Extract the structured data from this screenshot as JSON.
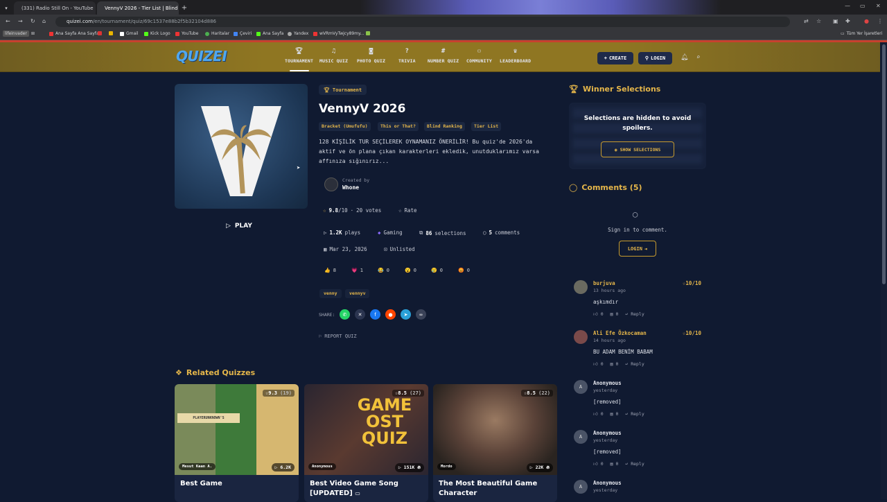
{
  "browser": {
    "tabs": [
      {
        "title": "(331) Radio Still On - YouTube"
      },
      {
        "title": "VennyV 2026 - Tier List | Blind R"
      }
    ],
    "url_domain": "quizei.com",
    "url_path": "/en/tournament/quiz/69c1537e88b2f5b32104d886",
    "bookmarks": [
      "lifeinvader",
      "Ana Sayfa Ana Sayfa",
      "Gmail",
      "Kick Logo",
      "YouTube",
      "Haritalar",
      "Çeviri",
      "Ana Sayfa",
      "Yandex",
      "wVRmVyTwjcy89my...",
      "Tüm Yer İşaretleri"
    ]
  },
  "site": {
    "logo": "QUIZEI",
    "nav": [
      {
        "label": "TOURNAMENT",
        "icon": "trophy-icon"
      },
      {
        "label": "MUSIC QUIZ",
        "icon": "music-icon"
      },
      {
        "label": "PHOTO QUIZ",
        "icon": "camera-icon"
      },
      {
        "label": "TRIVIA",
        "icon": "question-icon"
      },
      {
        "label": "NUMBER QUIZ",
        "icon": "hash-icon"
      },
      {
        "label": "COMMUNITY",
        "icon": "users-icon"
      },
      {
        "label": "LEADERBOARD",
        "icon": "medal-icon"
      }
    ],
    "create_label": "CREATE",
    "login_label": "LOGIN"
  },
  "quiz": {
    "cover_letter": "V",
    "play_label": "PLAY",
    "type_label": "Tournament",
    "title": "VennyV 2026",
    "categories": [
      "Bracket (Umufufu)",
      "This or That?",
      "Blind Ranking",
      "Tier List"
    ],
    "description": "128 KİŞİLİK TUR SEÇİLEREK OYNAMANIZ ÖNERİLİR! Bu quiz'de 2026'da aktif ve ön plana çıkan karakterleri ekledik, unutduklarımız varsa affınıza sığınırız...",
    "created_by_label": "Created by",
    "creator": "Whone",
    "rating": "9.8",
    "rating_max": "/10",
    "votes": "20 votes",
    "rate_label": "Rate",
    "plays": "1.2K",
    "plays_label": "plays",
    "category": "Gaming",
    "selections": "86",
    "selections_label": "selections",
    "comments_count": "5",
    "comments_label": "comments",
    "date": "Mar 23, 2026",
    "visibility": "Unlisted",
    "reactions": [
      {
        "emoji": "👍",
        "count": "8"
      },
      {
        "emoji": "💗",
        "count": "1"
      },
      {
        "emoji": "😂",
        "count": "0"
      },
      {
        "emoji": "😮",
        "count": "0"
      },
      {
        "emoji": "😢",
        "count": "0"
      },
      {
        "emoji": "😡",
        "count": "0"
      }
    ],
    "tags": [
      "venny",
      "vennyv"
    ],
    "share_label": "SHARE:",
    "report_label": "REPORT QUIZ"
  },
  "winner": {
    "title": "Winner Selections",
    "hidden_text": "Selections are hidden to avoid spoilers.",
    "show_label": "SHOW SELECTIONS"
  },
  "comments": {
    "title": "Comments (5)",
    "signin_text": "Sign in to comment.",
    "login_label": "LOGIN",
    "reply_label": "Reply",
    "items": [
      {
        "initial": "",
        "name": "burjuva",
        "time": "13 hours ago",
        "score": "10/10",
        "body": "aşkımdır",
        "likes": "0",
        "replies": "0"
      },
      {
        "initial": "",
        "name": "Ali Efe Özkocaman",
        "time": "14 hours ago",
        "score": "10/10",
        "body": "BU ADAM BENİM BABAM",
        "likes": "0",
        "replies": "0"
      },
      {
        "initial": "A",
        "name": "Anonymous",
        "time": "yesterday",
        "score": "",
        "body": "[removed]",
        "likes": "0",
        "replies": "0"
      },
      {
        "initial": "A",
        "name": "Anonymous",
        "time": "yesterday",
        "score": "",
        "body": "[removed]",
        "likes": "0",
        "replies": "0"
      },
      {
        "initial": "A",
        "name": "Anonymous",
        "time": "yesterday",
        "score": "",
        "body": "",
        "likes": "",
        "replies": ""
      }
    ]
  },
  "related": {
    "title": "Related Quizzes",
    "cards": [
      {
        "title": "Best Game",
        "rating": "9.3",
        "rating_count": "(19)",
        "author": "Mesut Kaan A.",
        "plays": "6.2K",
        "colors": [
          "#6b7a4a",
          "#c9b07a",
          "#3a8a3a"
        ]
      },
      {
        "title": "Best Video Game Song [UPDATED]",
        "rating": "8.5",
        "rating_count": "(27)",
        "author": "Anonymous",
        "plays": "151K",
        "colors": [
          "#2a2530",
          "#e0b43a",
          "#8a3c2a"
        ]
      },
      {
        "title": "The Most Beautiful Game Character",
        "rating": "8.5",
        "rating_count": "(22)",
        "author": "Mordo",
        "plays": "22K",
        "colors": [
          "#4a3a30",
          "#8a6a55",
          "#2a2420"
        ]
      }
    ],
    "image_texts": [
      "PLAYERUNKNOWN'S",
      "GAME",
      "OST",
      "QUIZ"
    ]
  },
  "colors": {
    "accent": "#e5b64a",
    "bg": "#101a31",
    "header": "#8f7622",
    "brand": "#4fa7f0"
  }
}
